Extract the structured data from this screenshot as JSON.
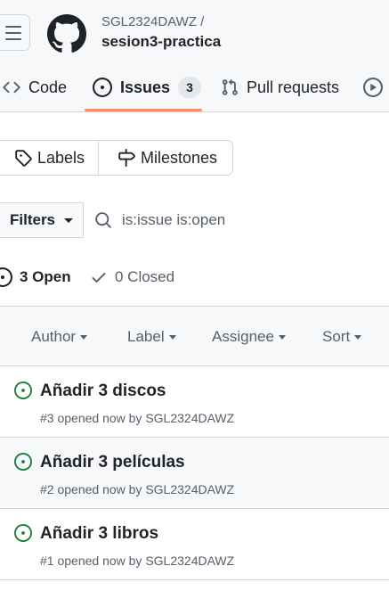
{
  "repo": {
    "owner": "SGL2324DAWZ /",
    "name": "sesion3-practica"
  },
  "tabs": {
    "code": "Code",
    "issues": "Issues",
    "issues_count": "3",
    "pulls": "Pull requests"
  },
  "buttons": {
    "labels": "Labels",
    "milestones": "Milestones",
    "filters": "Filters"
  },
  "search": {
    "value": "is:issue is:open"
  },
  "states": {
    "open": "3 Open",
    "closed": "0 Closed"
  },
  "sort_bar": {
    "author": "Author",
    "label": "Label",
    "assignee": "Assignee",
    "sort": "Sort"
  },
  "issues": [
    {
      "title": "Añadir 3 discos",
      "meta": "#3 opened now by SGL2324DAWZ"
    },
    {
      "title": "Añadir 3 películas",
      "meta": "#2 opened now by SGL2324DAWZ"
    },
    {
      "title": "Añadir 3 libros",
      "meta": "#1 opened now by SGL2324DAWZ"
    }
  ],
  "colors": {
    "open_green": "#1a7f37",
    "tab_underline": "#fd8c73",
    "border": "#d0d7de"
  }
}
